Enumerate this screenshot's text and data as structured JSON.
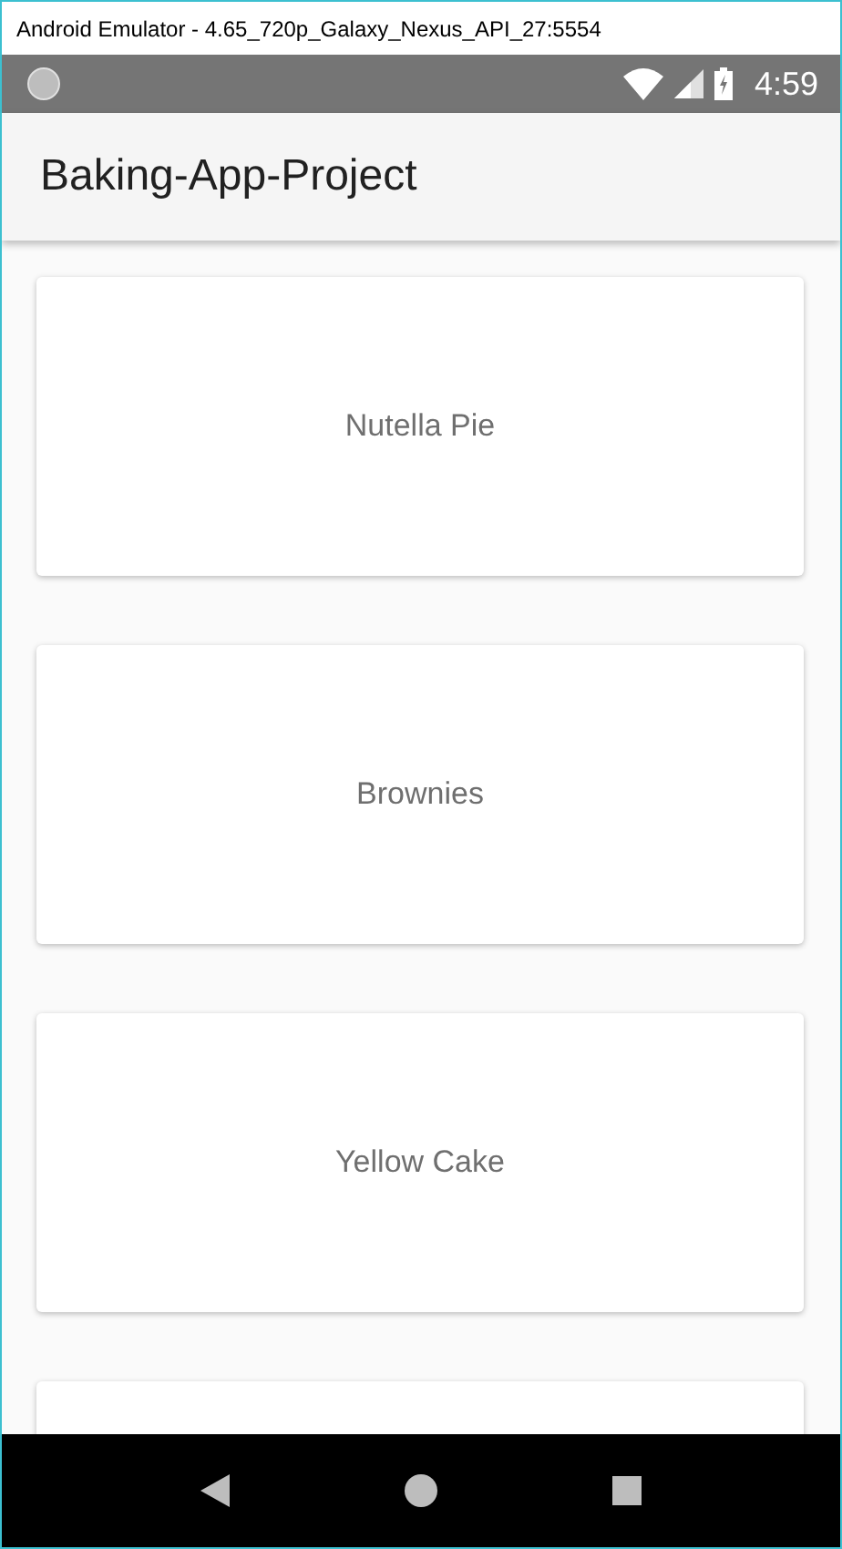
{
  "window": {
    "title": "Android Emulator - 4.65_720p_Galaxy_Nexus_API_27:5554"
  },
  "status_bar": {
    "time": "4:59"
  },
  "app_bar": {
    "title": "Baking-App-Project"
  },
  "recipes": [
    {
      "kind": "card",
      "name": "Nutella Pie"
    },
    {
      "kind": "card",
      "name": "Brownies"
    },
    {
      "kind": "card",
      "name": "Yellow Cake"
    },
    {
      "kind": "card"
    }
  ]
}
